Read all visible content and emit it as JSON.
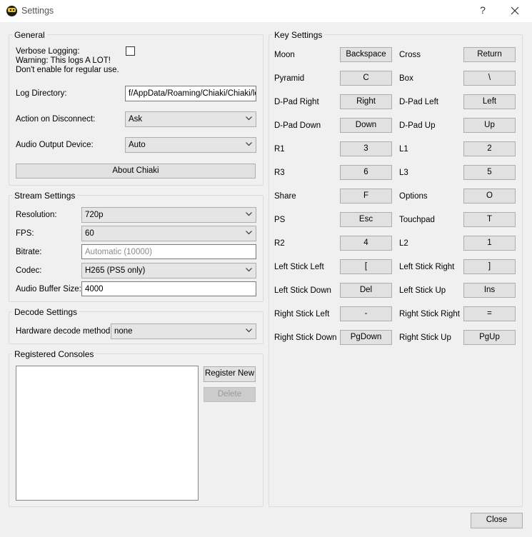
{
  "window": {
    "title": "Settings",
    "help_glyph": "?",
    "close_icon": "close-icon"
  },
  "general": {
    "title": "General",
    "verbose_label": "Verbose Logging:",
    "verbose_warning_1": "Warning: This logs A LOT!",
    "verbose_warning_2": "Don't enable for regular use.",
    "verbose_checked": false,
    "log_dir_label": "Log Directory:",
    "log_dir_value": "f/AppData/Roaming/Chiaki/Chiaki/log",
    "disconnect_label": "Action on Disconnect:",
    "disconnect_value": "Ask",
    "audio_out_label": "Audio Output Device:",
    "audio_out_value": "Auto",
    "about_button": "About Chiaki"
  },
  "stream": {
    "title": "Stream Settings",
    "resolution_label": "Resolution:",
    "resolution_value": "720p",
    "fps_label": "FPS:",
    "fps_value": "60",
    "bitrate_label": "Bitrate:",
    "bitrate_placeholder": "Automatic (10000)",
    "codec_label": "Codec:",
    "codec_value": "H265 (PS5 only)",
    "audio_buffer_label": "Audio Buffer Size:",
    "audio_buffer_value": "4000"
  },
  "decode": {
    "title": "Decode Settings",
    "hw_label": "Hardware decode method:",
    "hw_value": "none"
  },
  "consoles": {
    "title": "Registered Consoles",
    "register_button": "Register New",
    "delete_button": "Delete"
  },
  "keys": {
    "title": "Key Settings",
    "rows": [
      {
        "left_label": "Moon",
        "left_key": "Backspace",
        "right_label": "Cross",
        "right_key": "Return"
      },
      {
        "left_label": "Pyramid",
        "left_key": "C",
        "right_label": "Box",
        "right_key": "\\"
      },
      {
        "left_label": "D-Pad Right",
        "left_key": "Right",
        "right_label": "D-Pad Left",
        "right_key": "Left"
      },
      {
        "left_label": "D-Pad Down",
        "left_key": "Down",
        "right_label": "D-Pad Up",
        "right_key": "Up"
      },
      {
        "left_label": "R1",
        "left_key": "3",
        "right_label": "L1",
        "right_key": "2"
      },
      {
        "left_label": "R3",
        "left_key": "6",
        "right_label": "L3",
        "right_key": "5"
      },
      {
        "left_label": "Share",
        "left_key": "F",
        "right_label": "Options",
        "right_key": "O"
      },
      {
        "left_label": "PS",
        "left_key": "Esc",
        "right_label": "Touchpad",
        "right_key": "T"
      },
      {
        "left_label": "R2",
        "left_key": "4",
        "right_label": "L2",
        "right_key": "1"
      },
      {
        "left_label": "Left Stick Left",
        "left_key": "[",
        "right_label": "Left Stick Right",
        "right_key": "]"
      },
      {
        "left_label": "Left Stick Down",
        "left_key": "Del",
        "right_label": "Left Stick Up",
        "right_key": "Ins"
      },
      {
        "left_label": "Right Stick Left",
        "left_key": "-",
        "right_label": "Right Stick Right",
        "right_key": "="
      },
      {
        "left_label": "Right Stick Down",
        "left_key": "PgDown",
        "right_label": "Right Stick Up",
        "right_key": "PgUp"
      }
    ]
  },
  "footer": {
    "close_button": "Close"
  }
}
